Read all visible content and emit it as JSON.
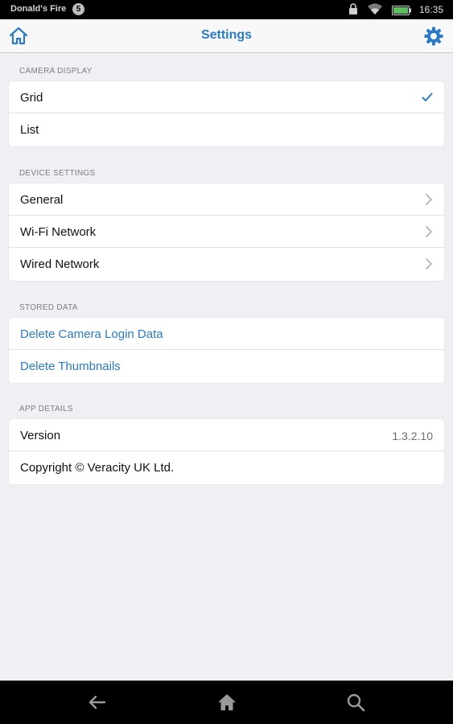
{
  "status_bar": {
    "device_name": "Donald's Fire",
    "notification_glyph": "5",
    "time": "16:35",
    "icons": [
      "lock-icon",
      "wifi-icon",
      "battery-icon"
    ]
  },
  "nav": {
    "title": "Settings",
    "left_icon": "home-icon",
    "right_icon": "gear-icon",
    "accent_color": "#2a7ac8"
  },
  "sections": {
    "camera_display": {
      "header": "CAMERA DISPLAY",
      "items": [
        {
          "label": "Grid",
          "selected": true
        },
        {
          "label": "List",
          "selected": false
        }
      ]
    },
    "device_settings": {
      "header": "DEVICE SETTINGS",
      "items": [
        {
          "label": "General"
        },
        {
          "label": "Wi-Fi Network"
        },
        {
          "label": "Wired Network"
        }
      ]
    },
    "stored_data": {
      "header": "STORED DATA",
      "items": [
        {
          "label": "Delete Camera Login Data"
        },
        {
          "label": "Delete Thumbnails"
        }
      ]
    },
    "app_details": {
      "header": "APP DETAILS",
      "items": [
        {
          "label": "Version",
          "value": "1.3.2.10"
        },
        {
          "label": "Copyright © Veracity UK Ltd."
        }
      ]
    }
  },
  "bottom_nav": {
    "icons": [
      "back-arrow-icon",
      "home-icon",
      "search-icon"
    ]
  }
}
